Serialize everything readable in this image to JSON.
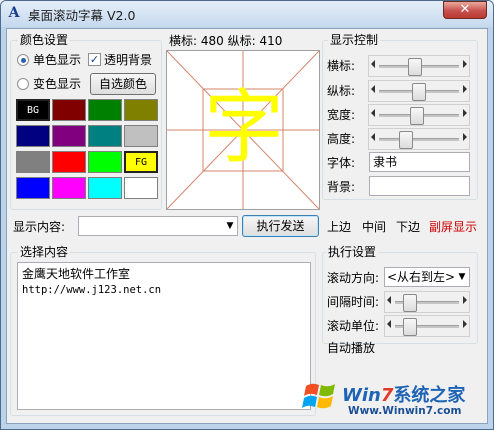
{
  "window": {
    "title": "桌面滚动字幕 V2.0",
    "app_icon": "A",
    "close_glyph": "✕"
  },
  "color_settings": {
    "group_title": "颜色设置",
    "single_color_label": "单色显示",
    "multi_color_label": "变色显示",
    "transparent_bg_label": "透明背景",
    "transparent_bg_checked": true,
    "custom_color_button": "自选颜色",
    "selected_mode": "single",
    "swatches": [
      {
        "color": "#000000",
        "text": "BG",
        "text_color": "#ffffff",
        "selected": true
      },
      {
        "color": "#800000",
        "text": "",
        "text_color": "#ffffff",
        "selected": false
      },
      {
        "color": "#008000",
        "text": "",
        "text_color": "#ffffff",
        "selected": false
      },
      {
        "color": "#808000",
        "text": "",
        "text_color": "#ffffff",
        "selected": false
      },
      {
        "color": "#000080",
        "text": "",
        "text_color": "#ffffff",
        "selected": false
      },
      {
        "color": "#800080",
        "text": "",
        "text_color": "#ffffff",
        "selected": false
      },
      {
        "color": "#008080",
        "text": "",
        "text_color": "#ffffff",
        "selected": false
      },
      {
        "color": "#c0c0c0",
        "text": "",
        "text_color": "#000000",
        "selected": false
      },
      {
        "color": "#808080",
        "text": "",
        "text_color": "#ffffff",
        "selected": false
      },
      {
        "color": "#ff0000",
        "text": "",
        "text_color": "#ffffff",
        "selected": false
      },
      {
        "color": "#00ff00",
        "text": "",
        "text_color": "#000000",
        "selected": false
      },
      {
        "color": "#ffff00",
        "text": "FG",
        "text_color": "#000000",
        "selected": true
      },
      {
        "color": "#0000ff",
        "text": "",
        "text_color": "#ffffff",
        "selected": false
      },
      {
        "color": "#ff00ff",
        "text": "",
        "text_color": "#ffffff",
        "selected": false
      },
      {
        "color": "#00ffff",
        "text": "",
        "text_color": "#000000",
        "selected": false
      },
      {
        "color": "#ffffff",
        "text": "",
        "text_color": "#000000",
        "selected": false
      }
    ]
  },
  "preview": {
    "x_label": "横标:",
    "x_value": "480",
    "y_label": "纵标:",
    "y_value": "410",
    "char": "字",
    "char_color": "#ffff00",
    "guide_color": "#d4846a"
  },
  "display_control": {
    "group_title": "显示控制",
    "x_label": "横标:",
    "y_label": "纵标:",
    "width_label": "宽度:",
    "height_label": "高度:",
    "font_label": "字体:",
    "font_value": "隶书",
    "bg_label": "背景:",
    "bg_value": "",
    "x_level": 0.42,
    "y_level": 0.48,
    "width_level": 0.45,
    "height_level": 0.28
  },
  "content_row": {
    "label": "显示内容:",
    "value": "",
    "execute_button": "执行发送",
    "top_link": "上边",
    "middle_link": "中间",
    "bottom_link": "下边",
    "secondary_link": "副屏显示",
    "secondary_color": "#cc0000"
  },
  "select_content": {
    "group_title": "选择内容",
    "lines": [
      "金鹰天地软件工作室",
      "http://www.j123.net.cn"
    ]
  },
  "exec_settings": {
    "group_title": "执行设置",
    "direction_label": "滚动方向:",
    "direction_value": "<从右到左>",
    "interval_label": "间隔时间:",
    "unit_label": "滚动单位:",
    "auto_play_label": "自动播放",
    "interval_level": 0.12,
    "unit_level": 0.12
  },
  "watermark": {
    "brand_part1": "Win",
    "brand_num": "7",
    "brand_part2": "系统之家",
    "url": "Www.Winwin7.com"
  }
}
